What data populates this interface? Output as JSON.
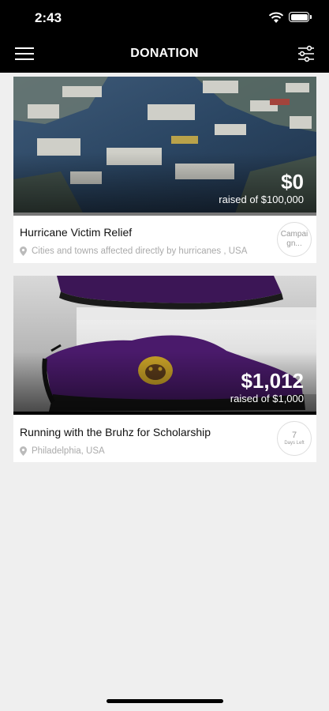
{
  "status_bar": {
    "time": "2:43"
  },
  "header": {
    "title": "DONATION",
    "menu_icon": "hamburger-menu-icon",
    "filter_icon": "sliders-filter-icon"
  },
  "campaigns": [
    {
      "amount": "$0",
      "raised_text": "raised of $100,000",
      "name": "Hurricane Victim Relief",
      "location": "Cities and towns affected directly by hurricanes , USA",
      "badge": "Campaign...",
      "progress": 0
    },
    {
      "amount": "$1,012",
      "raised_text": "raised of $1,000",
      "name": "Running with the Bruhz for Scholarship",
      "location": "Philadelphia, USA",
      "badge_number": "7",
      "badge_label": "Days Left",
      "progress": 1
    }
  ],
  "colors": {
    "bar": "#000000",
    "accent_purple": "#4a1a6b",
    "accent_gold": "#c9a227"
  }
}
